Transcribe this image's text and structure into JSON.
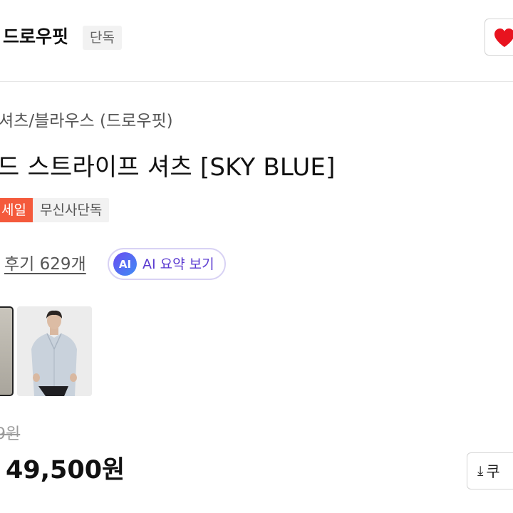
{
  "header": {
    "brand_name": "드로우핏",
    "exclusive_tag": "단독",
    "like_icon": "heart-icon",
    "like_color": "#e8131f"
  },
  "product": {
    "category": "셔츠/블라우스 (드로우핏)",
    "title": "드 스트라이프 셔츠 [SKY BLUE]",
    "badges": {
      "sale": "세일",
      "exclusive": "무신사단독"
    },
    "review_link": "후기 629개",
    "ai_summary": {
      "icon_text": "AI",
      "label": "AI 요약 보기"
    },
    "original_price": "9원",
    "sale_price": "49,500원",
    "coupon": {
      "icon": "download-icon",
      "label": "쿠"
    }
  },
  "colors": {
    "sale_badge": "#f45a3c",
    "ai_accent": "#5a3ad0",
    "heart": "#e8131f"
  }
}
